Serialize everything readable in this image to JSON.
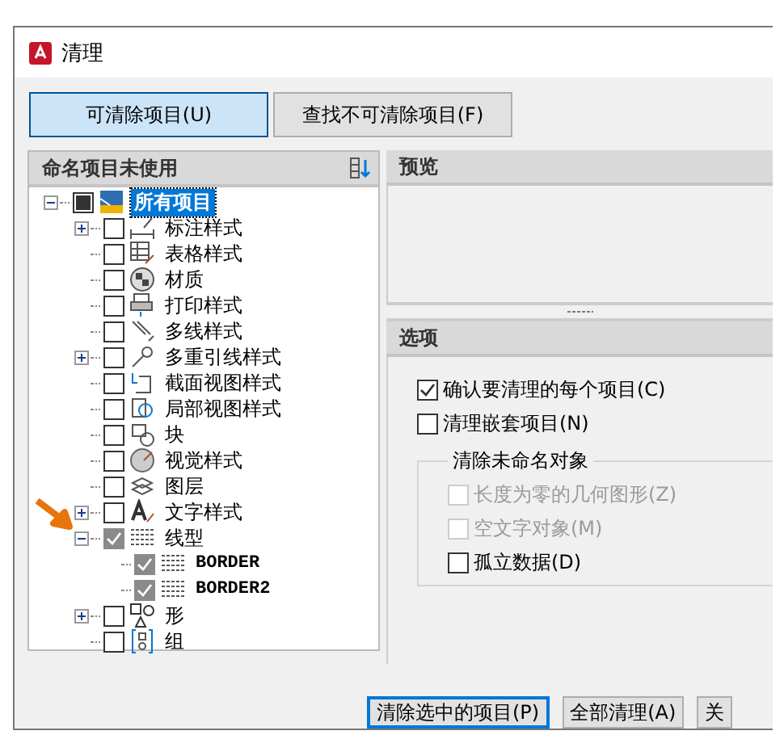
{
  "window": {
    "title": "清理"
  },
  "tabs": [
    {
      "label": "可清除项目(U)",
      "selected": true
    },
    {
      "label": "查找不可清除项目(F)",
      "selected": false
    }
  ],
  "tree": {
    "header": "命名项目未使用",
    "items": [
      {
        "label": "所有项目",
        "checked": false,
        "partial": true,
        "expanded": true,
        "selected": true,
        "children": [
          {
            "label": "标注样式",
            "checked": false,
            "expanded": false
          },
          {
            "label": "表格样式",
            "checked": false
          },
          {
            "label": "材质",
            "checked": false
          },
          {
            "label": "打印样式",
            "checked": false
          },
          {
            "label": "多线样式",
            "checked": false
          },
          {
            "label": "多重引线样式",
            "checked": false,
            "expanded": false
          },
          {
            "label": "截面视图样式",
            "checked": false
          },
          {
            "label": "局部视图样式",
            "checked": false
          },
          {
            "label": "块",
            "checked": false
          },
          {
            "label": "视觉样式",
            "checked": false
          },
          {
            "label": "图层",
            "checked": false
          },
          {
            "label": "文字样式",
            "checked": false,
            "expanded": false
          },
          {
            "label": "线型",
            "checked": true,
            "expanded": true,
            "children": [
              {
                "label": "BORDER",
                "checked": true
              },
              {
                "label": "BORDER2",
                "checked": true
              }
            ]
          },
          {
            "label": "形",
            "checked": false,
            "expanded": false
          },
          {
            "label": "组",
            "checked": false
          }
        ]
      }
    ]
  },
  "preview": {
    "header": "预览"
  },
  "options": {
    "header": "选项",
    "items": [
      {
        "label": "确认要清理的每个项目(C)",
        "checked": true,
        "disabled": false
      },
      {
        "label": "清理嵌套项目(N)",
        "checked": false,
        "disabled": false
      }
    ],
    "group": {
      "title": "清除未命名对象",
      "items": [
        {
          "label": "长度为零的几何图形(Z)",
          "checked": false,
          "disabled": true
        },
        {
          "label": "空文字对象(M)",
          "checked": false,
          "disabled": true
        },
        {
          "label": "孤立数据(D)",
          "checked": false,
          "disabled": false
        }
      ]
    }
  },
  "buttons": [
    {
      "label": "清除选中的项目(P)",
      "default": true
    },
    {
      "label": "全部清理(A)",
      "default": false
    },
    {
      "label": "关",
      "default": false
    }
  ]
}
